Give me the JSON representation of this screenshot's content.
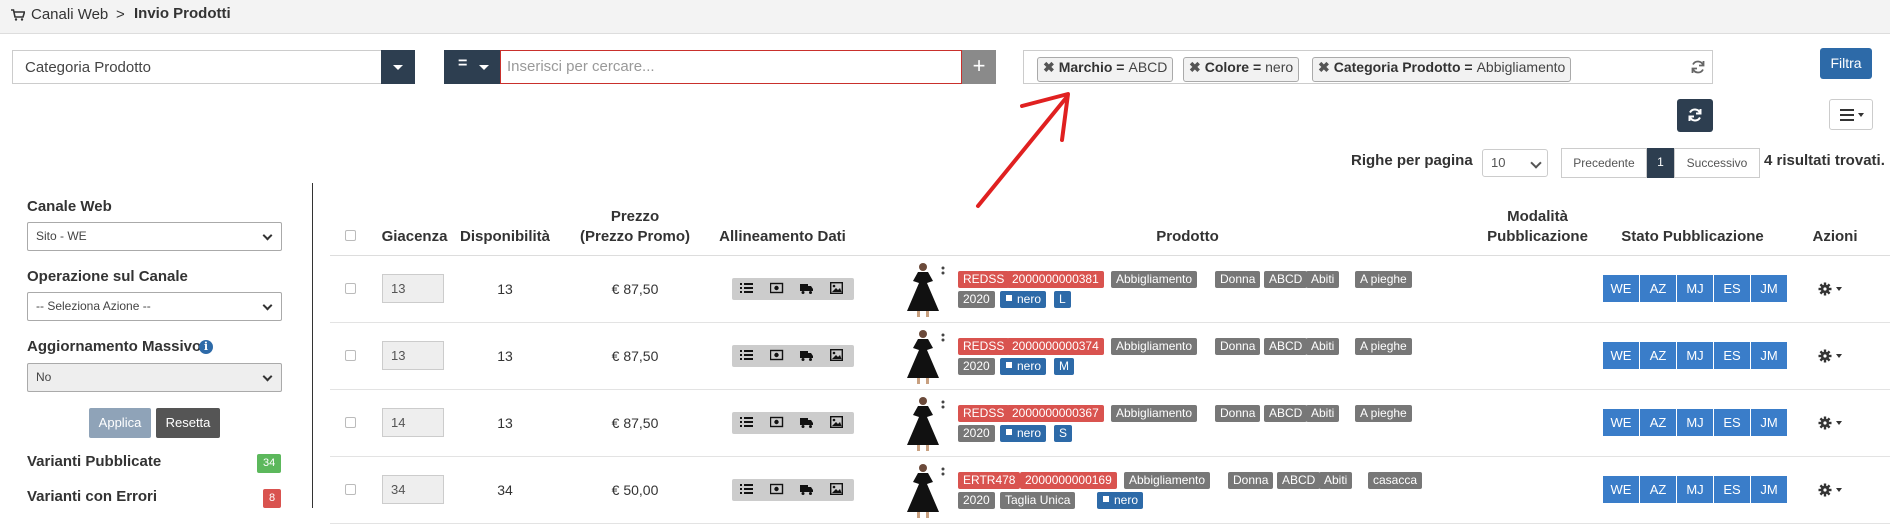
{
  "breadcrumb": {
    "parent": "Canali Web",
    "separator": ">",
    "current": "Invio Prodotti"
  },
  "filter_bar": {
    "category_select": "Categoria Prodotto",
    "operator": "=",
    "search_placeholder": "Inserisci per cercare...",
    "plus": "+",
    "tags": [
      {
        "key": "Marchio =",
        "value": "ABCD"
      },
      {
        "key": "Colore =",
        "value": "nero"
      },
      {
        "key": "Categoria Prodotto =",
        "value": "Abbigliamento"
      }
    ],
    "filter_button": "Filtra"
  },
  "pagination": {
    "rows_per_page_label": "Righe per pagina",
    "rows_per_page_value": "10",
    "prev": "Precedente",
    "page": "1",
    "next": "Successivo",
    "results": "4 risultati trovati."
  },
  "left_panel": {
    "channel_label": "Canale Web",
    "channel_value": "Sito - WE",
    "operation_label": "Operazione sul Canale",
    "operation_value": "-- Seleziona Azione --",
    "mass_update_label": "Aggiornamento Massivo",
    "mass_update_value": "No",
    "apply": "Applica",
    "reset": "Resetta",
    "published_label": "Varianti Pubblicate",
    "published_count": "34",
    "errors_label": "Varianti con Errori",
    "errors_count": "8"
  },
  "table": {
    "headers": {
      "giacenza": "Giacenza",
      "disponibilita": "Disponibilità",
      "prezzo_1": "Prezzo",
      "prezzo_2": "(Prezzo Promo)",
      "allineamento": "Allineamento Dati",
      "prodotto": "Prodotto",
      "modalita_1": "Modalità",
      "modalita_2": "Pubblicazione",
      "stato": "Stato Pubblicazione",
      "azioni": "Azioni"
    },
    "publish_channels": [
      "WE",
      "AZ",
      "MJ",
      "ES",
      "JM"
    ],
    "rows": [
      {
        "giacenza": "13",
        "disponibilita": "13",
        "prezzo": "€ 87,50",
        "labels1": [
          "REDSS",
          "2000000000381",
          "Abbigliamento",
          "Donna",
          "ABCD",
          "Abiti",
          "A pieghe"
        ],
        "labels2": [
          "2020",
          "nero",
          "L"
        ]
      },
      {
        "giacenza": "13",
        "disponibilita": "13",
        "prezzo": "€ 87,50",
        "labels1": [
          "REDSS",
          "2000000000374",
          "Abbigliamento",
          "Donna",
          "ABCD",
          "Abiti",
          "A pieghe"
        ],
        "labels2": [
          "2020",
          "nero",
          "M"
        ]
      },
      {
        "giacenza": "14",
        "disponibilita": "13",
        "prezzo": "€ 87,50",
        "labels1": [
          "REDSS",
          "2000000000367",
          "Abbigliamento",
          "Donna",
          "ABCD",
          "Abiti",
          "A pieghe"
        ],
        "labels2": [
          "2020",
          "nero",
          "S"
        ]
      },
      {
        "giacenza": "34",
        "disponibilita": "34",
        "prezzo": "€ 50,00",
        "labels1": [
          "ERTR478",
          "2000000000169",
          "Abbigliamento",
          "Donna",
          "ABCD",
          "Abiti",
          "casacca"
        ],
        "labels2": [
          "2020",
          "Taglia Unica",
          "nero"
        ]
      }
    ]
  },
  "colors": {
    "dark": "#2d3e50",
    "primary": "#2d6aa8",
    "danger": "#d9534f",
    "success": "#5cb85c",
    "publish": "#3a7dc9",
    "annotation_arrow": "#e02020"
  },
  "icons": [
    "shopping-cart-icon",
    "caret-down-icon",
    "plus-icon",
    "close-icon",
    "refresh-icon",
    "hamburger-menu-icon",
    "info-icon",
    "list-icon",
    "money-icon",
    "truck-icon",
    "image-icon",
    "gear-icon"
  ]
}
